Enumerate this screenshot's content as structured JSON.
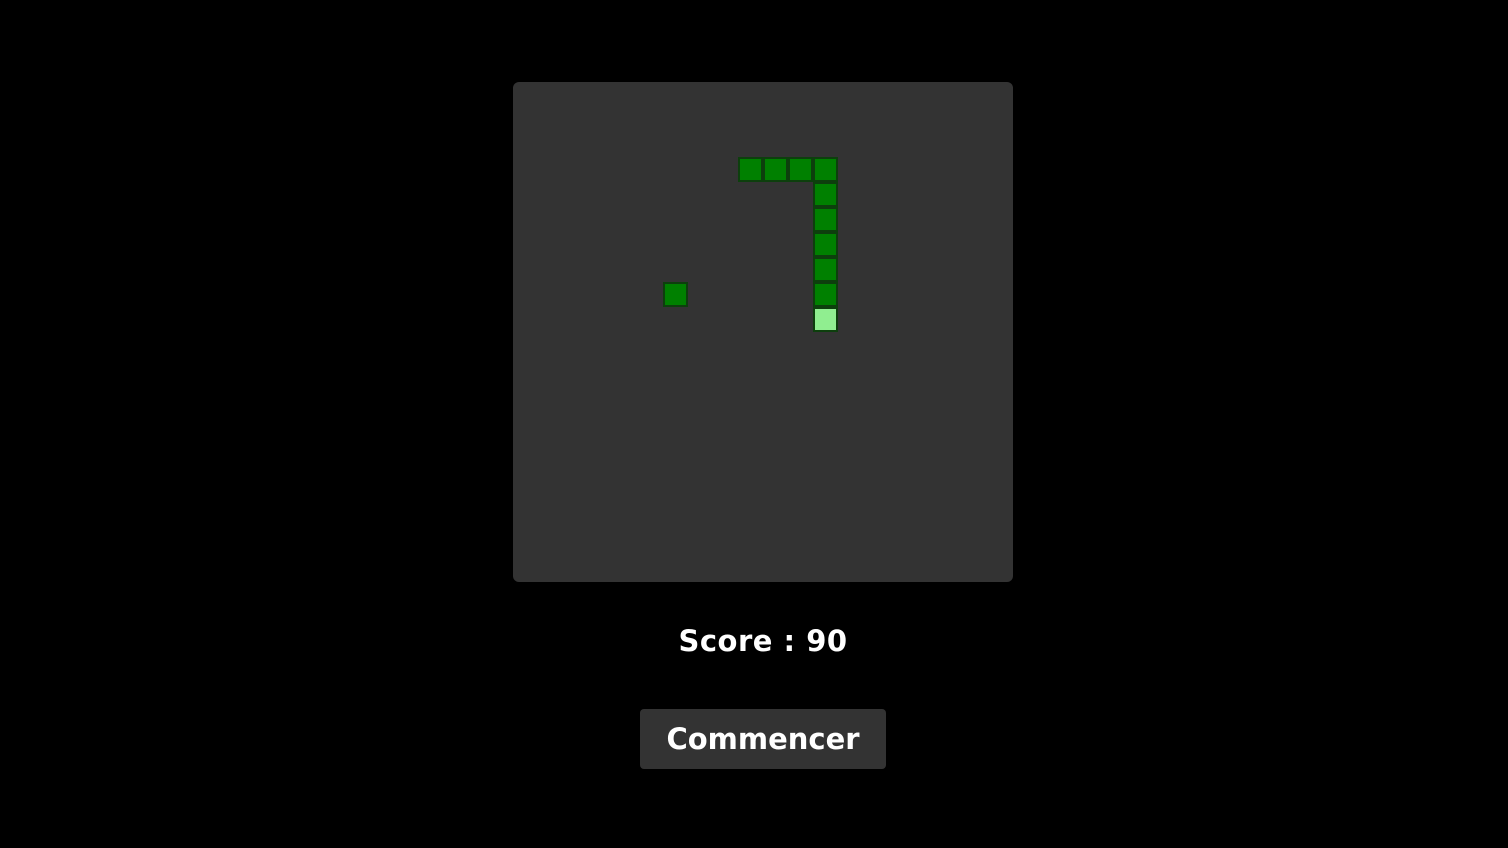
{
  "game": {
    "grid_size": 20,
    "snake": [
      {
        "col": 12,
        "row": 9
      },
      {
        "col": 12,
        "row": 8
      },
      {
        "col": 12,
        "row": 7
      },
      {
        "col": 12,
        "row": 6
      },
      {
        "col": 12,
        "row": 5
      },
      {
        "col": 12,
        "row": 4
      },
      {
        "col": 12,
        "row": 3
      },
      {
        "col": 11,
        "row": 3
      },
      {
        "col": 10,
        "row": 3
      },
      {
        "col": 9,
        "row": 3
      }
    ],
    "food": {
      "col": 6,
      "row": 8
    },
    "colors": {
      "board": "#333333",
      "snake_body": "#008000",
      "snake_head": "#90ee90",
      "food": "#008000",
      "cell_border": "#0d3f0d"
    }
  },
  "score": {
    "text": "Score : 90"
  },
  "controls": {
    "start_label": "Commencer"
  }
}
